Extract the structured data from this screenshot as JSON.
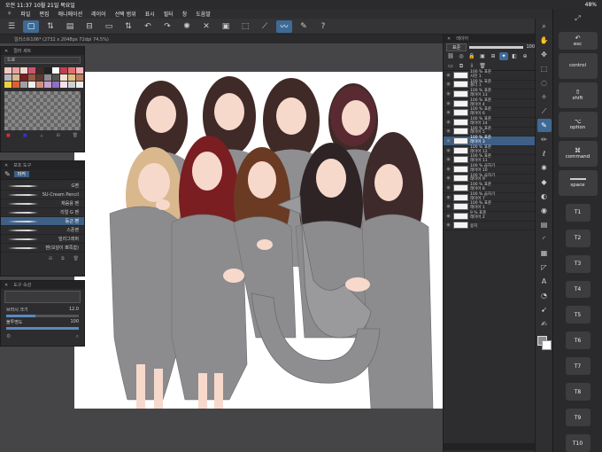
{
  "status": {
    "time_date": "오전 11:37   10월 21일 목요일",
    "battery": "48%"
  },
  "menu": [
    "파일",
    "편집",
    "애니메이션",
    "레이어",
    "선택 범위",
    "표시",
    "필터",
    "창",
    "도움말"
  ],
  "document_tab": "일러스트106* (2732 x 2048px 72dpi 74.5%)",
  "palettes": {
    "color_set_title": "컬러 세트",
    "color_set_dropdown": "드로",
    "brush_title": "보조 도구",
    "brush_group": "마커",
    "brushes": [
      "G펜",
      "SU-Cream Pencil",
      "채움용 펜",
      "리얼 G 펜",
      "둥근 펜",
      "스푼펜",
      "밀리그래퍼",
      "펜(모달이 뾰족함)"
    ],
    "selected_brush": "둥근 펜",
    "props_title": "도구 속성",
    "brush_size_label": "브러시 크기",
    "brush_size_value": "12.0",
    "opacity_label": "불투명도",
    "opacity_value": "100"
  },
  "layers": {
    "tab": "레이어",
    "blend": "표준",
    "opacity": "100",
    "rows": [
      {
        "pct": "100 %",
        "mode": "표준",
        "name": "사진 1",
        "selected": false
      },
      {
        "pct": "100 %",
        "mode": "표준",
        "name": "폴더 1",
        "selected": false
      },
      {
        "pct": "100 %",
        "mode": "표준",
        "name": "레이어 13",
        "selected": false
      },
      {
        "pct": "100 %",
        "mode": "표준",
        "name": "레이어 4",
        "selected": false
      },
      {
        "pct": "100 %",
        "mode": "표준",
        "name": "레이어 6",
        "selected": false
      },
      {
        "pct": "100 %",
        "mode": "표준",
        "name": "레이어 14",
        "selected": false
      },
      {
        "pct": "100 %",
        "mode": "표준",
        "name": "레이어 5",
        "selected": false
      },
      {
        "pct": "100 %",
        "mode": "표준",
        "name": "레이어 3",
        "selected": true
      },
      {
        "pct": "100 %",
        "mode": "표준",
        "name": "레이어 12",
        "selected": false
      },
      {
        "pct": "100 %",
        "mode": "표준",
        "name": "레이어 11",
        "selected": false
      },
      {
        "pct": "100 %",
        "mode": "곱하기",
        "name": "레이어 10",
        "selected": false
      },
      {
        "pct": "100 %",
        "mode": "곱하기",
        "name": "레이어 9",
        "selected": false
      },
      {
        "pct": "100 %",
        "mode": "표준",
        "name": "레이어 8",
        "selected": false
      },
      {
        "pct": "100 %",
        "mode": "곱하기",
        "name": "레이어 7",
        "selected": false
      },
      {
        "pct": "100 %",
        "mode": "표준",
        "name": "레이어 1",
        "selected": false
      },
      {
        "pct": "9 %",
        "mode": "표준",
        "name": "레이어 2",
        "selected": false
      },
      {
        "pct": "",
        "mode": "",
        "name": "용지",
        "selected": false
      }
    ]
  },
  "sidebar_keys": [
    "esc",
    "control",
    "shift",
    "option",
    "command",
    "space"
  ],
  "function_keys": [
    "T1",
    "T2",
    "T3",
    "T4",
    "T5",
    "T6",
    "T7",
    "T8",
    "T9",
    "T10"
  ]
}
